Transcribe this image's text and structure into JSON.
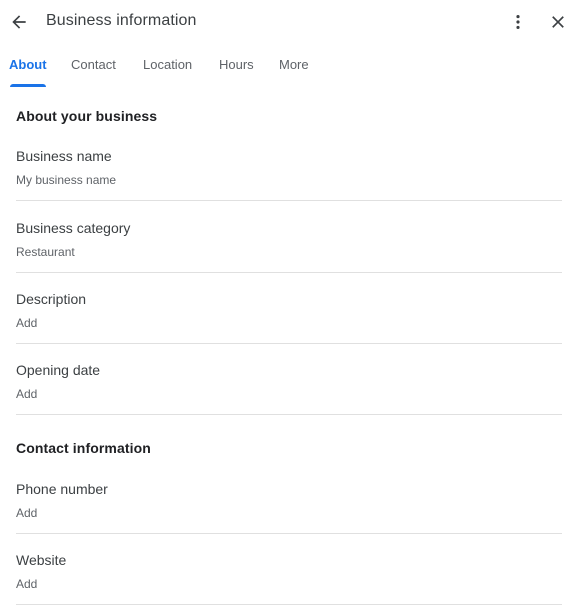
{
  "header": {
    "title": "Business information",
    "back_icon": "arrow-back-icon",
    "more_icon": "more-vertical-icon",
    "close_icon": "close-icon"
  },
  "tabs": [
    {
      "label": "About",
      "active": true
    },
    {
      "label": "Contact",
      "active": false
    },
    {
      "label": "Location",
      "active": false
    },
    {
      "label": "Hours",
      "active": false
    },
    {
      "label": "More",
      "active": false
    }
  ],
  "colors": {
    "accent": "#1a73e8",
    "divider": "#e0e0e0",
    "text_primary": "#202124",
    "text_secondary": "#5f6368"
  },
  "sections": {
    "about": {
      "title": "About your business",
      "fields": [
        {
          "label": "Business name",
          "value": "My business name"
        },
        {
          "label": "Business category",
          "value": "Restaurant"
        },
        {
          "label": "Description",
          "value": "Add"
        },
        {
          "label": "Opening date",
          "value": "Add"
        }
      ]
    },
    "contact": {
      "title": "Contact information",
      "fields": [
        {
          "label": "Phone number",
          "value": "Add"
        },
        {
          "label": "Website",
          "value": "Add"
        }
      ]
    }
  }
}
